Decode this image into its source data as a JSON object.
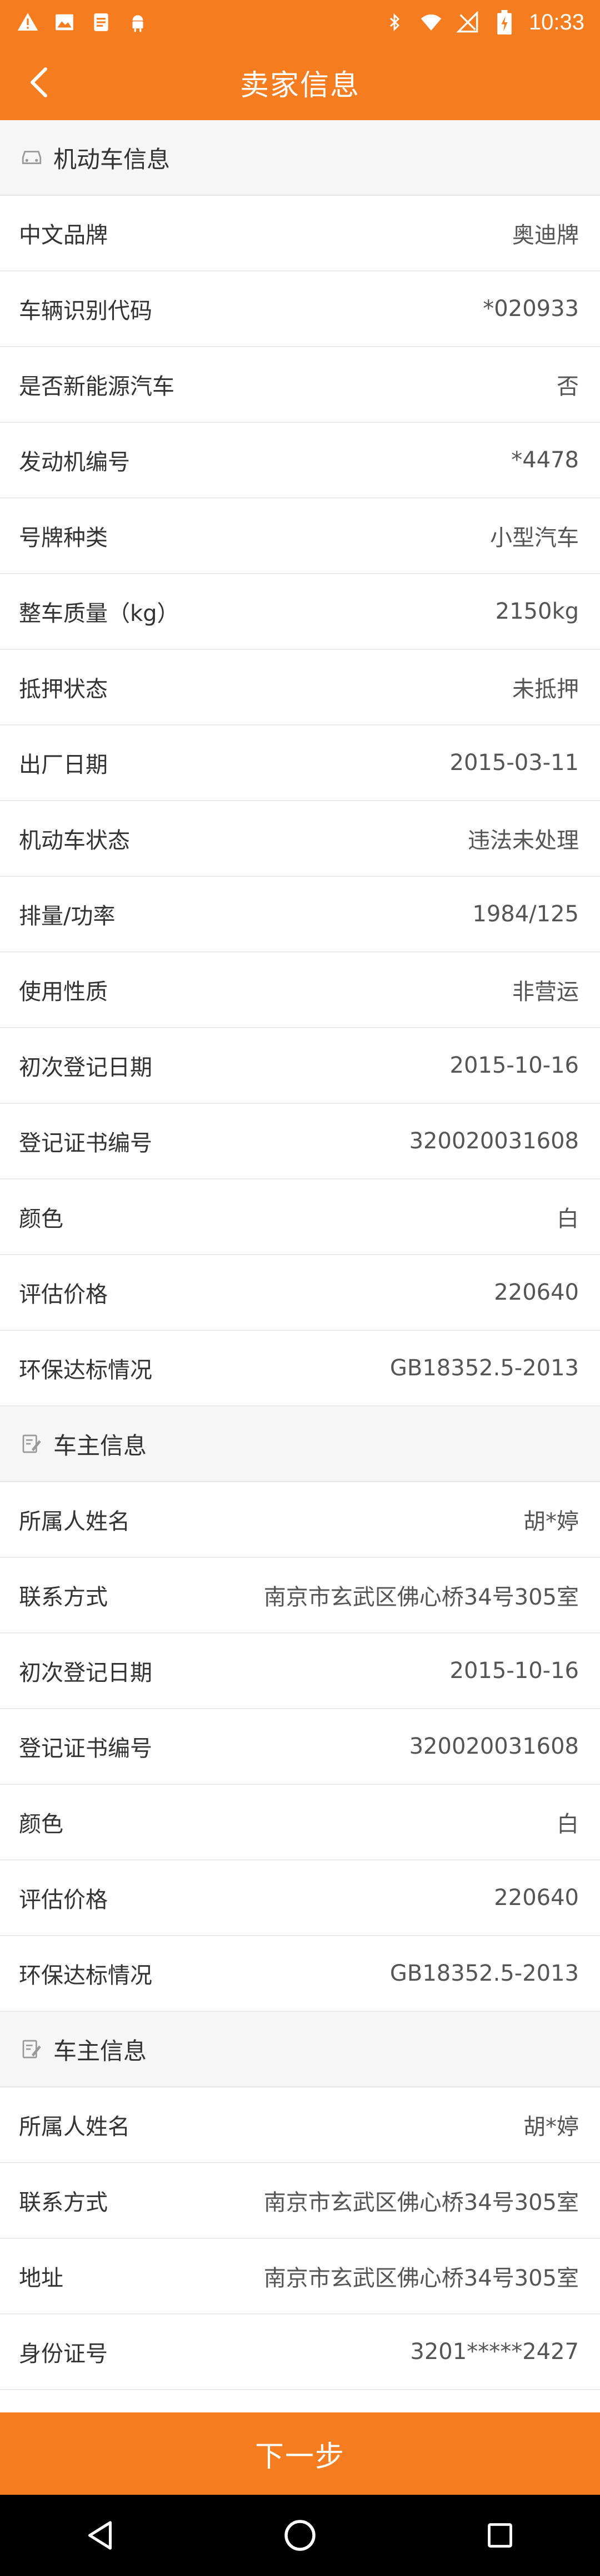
{
  "status_bar": {
    "time": "10:33",
    "left_icons": [
      "warning-icon",
      "image-icon",
      "document-icon",
      "android-icon"
    ],
    "right_icons": [
      "bluetooth-icon",
      "wifi-icon",
      "no-signal-icon",
      "battery-icon"
    ]
  },
  "header": {
    "title": "卖家信息"
  },
  "sections": [
    {
      "title": "机动车信息",
      "icon": "car-icon",
      "rows": [
        {
          "label": "中文品牌",
          "value": "奥迪牌"
        },
        {
          "label": "车辆识别代码",
          "value": "*020933"
        },
        {
          "label": "是否新能源汽车",
          "value": "否"
        },
        {
          "label": "发动机编号",
          "value": "*4478"
        },
        {
          "label": "号牌种类",
          "value": "小型汽车"
        },
        {
          "label": "整车质量（kg）",
          "value": "2150kg"
        },
        {
          "label": "抵押状态",
          "value": "未抵押"
        },
        {
          "label": "出厂日期",
          "value": "2015-03-11"
        },
        {
          "label": "机动车状态",
          "value": "违法未处理"
        },
        {
          "label": "排量/功率",
          "value": "1984/125"
        },
        {
          "label": "使用性质",
          "value": "非营运"
        },
        {
          "label": "初次登记日期",
          "value": "2015-10-16"
        },
        {
          "label": "登记证书编号",
          "value": "320020031608"
        },
        {
          "label": "颜色",
          "value": "白"
        },
        {
          "label": "评估价格",
          "value": "220640"
        },
        {
          "label": "环保达标情况",
          "value": "GB18352.5-2013"
        }
      ]
    },
    {
      "title": "车主信息",
      "icon": "edit-note-icon",
      "rows": [
        {
          "label": "所属人姓名",
          "value": "胡*婷"
        },
        {
          "label": "联系方式",
          "value": "南京市玄武区佛心桥34号305室"
        },
        {
          "label": "初次登记日期",
          "value": "2015-10-16"
        },
        {
          "label": "登记证书编号",
          "value": "320020031608"
        },
        {
          "label": "颜色",
          "value": "白"
        },
        {
          "label": "评估价格",
          "value": "220640"
        },
        {
          "label": "环保达标情况",
          "value": "GB18352.5-2013"
        }
      ]
    },
    {
      "title": "车主信息",
      "icon": "edit-note-icon",
      "rows": [
        {
          "label": "所属人姓名",
          "value": "胡*婷"
        },
        {
          "label": "联系方式",
          "value": "南京市玄武区佛心桥34号305室"
        },
        {
          "label": "地址",
          "value": "南京市玄武区佛心桥34号305室"
        },
        {
          "label": "身份证号",
          "value": "3201*****2427"
        }
      ]
    }
  ],
  "footer": {
    "next_label": "下一步"
  },
  "nav_bar": {
    "icons": [
      "back-triangle-icon",
      "home-circle-icon",
      "recents-square-icon"
    ]
  },
  "colors": {
    "accent": "#f57c1f",
    "section_bg": "#f6f6f6",
    "divider": "#e9e9e9"
  }
}
